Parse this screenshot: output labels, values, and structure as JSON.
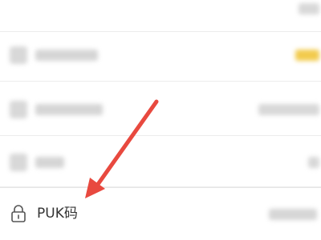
{
  "puk_row": {
    "label": "PUK码",
    "icon": "lock-icon"
  },
  "colors": {
    "annotation_arrow": "#e8493f",
    "highlight_value": "#f2cb4d",
    "label_text": "#333333"
  }
}
